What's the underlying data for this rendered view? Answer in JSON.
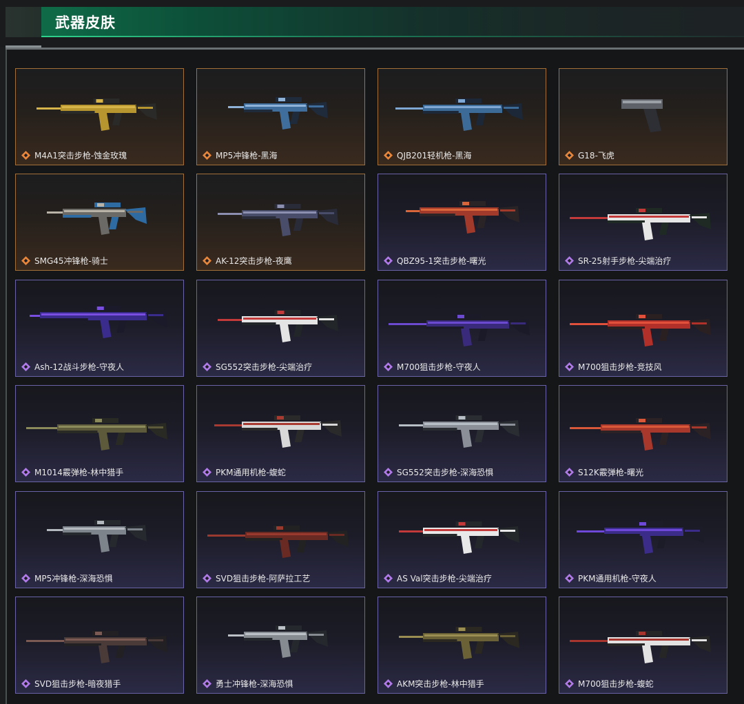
{
  "header": {
    "title": "武器皮肤"
  },
  "colors": {
    "gold_border": "#a4703a",
    "purple_border": "#6b63a8",
    "gold_icon": "#e8863a",
    "purple_icon": "#b07be8",
    "header_green": "#0f6b48"
  },
  "cards": [
    {
      "label": "M4A1突击步枪-蚀金玫瑰",
      "rarity": "gold",
      "icon": "diamond-gold-icon",
      "palette": [
        "#b8962f",
        "#2a2a28",
        "#d8b54a"
      ]
    },
    {
      "label": "MP5冲锋枪-黑海",
      "rarity": "gold",
      "icon": "diamond-gold-icon",
      "palette": [
        "#3f6e9c",
        "#1f2a3a",
        "#8fb3d8"
      ]
    },
    {
      "label": "QJB201轻机枪-黑海",
      "rarity": "gold",
      "icon": "diamond-gold-icon",
      "palette": [
        "#3c6b98",
        "#1c2838",
        "#7fa8d4"
      ]
    },
    {
      "label": "G18-飞虎",
      "rarity": "gold",
      "icon": "diamond-gold-icon",
      "palette": [
        "#2d2f35",
        "#5f6168",
        "#9aa0a6"
      ]
    },
    {
      "label": "SMG45冲锋枪-骑士",
      "rarity": "gold",
      "icon": "diamond-gold-icon",
      "palette": [
        "#6b6a66",
        "#2e6ba3",
        "#b8b3a6"
      ]
    },
    {
      "label": "AK-12突击步枪-夜鹰",
      "rarity": "gold",
      "icon": "diamond-gold-icon",
      "palette": [
        "#4a4d6a",
        "#2a2b38",
        "#8c8fb0"
      ]
    },
    {
      "label": "QBZ95-1突击步枪-曙光",
      "rarity": "purple",
      "icon": "diamond-purple-icon",
      "palette": [
        "#a13a2a",
        "#2a2426",
        "#d9653a"
      ]
    },
    {
      "label": "SR-25射手步枪-尖端治疗",
      "rarity": "purple",
      "icon": "diamond-purple-icon",
      "palette": [
        "#e6e6e6",
        "#1f2a24",
        "#c43a3a"
      ]
    },
    {
      "label": "Ash-12战斗步枪-守夜人",
      "rarity": "purple",
      "icon": "diamond-purple-icon",
      "palette": [
        "#3a2c8c",
        "#1a1a2a",
        "#7a4ee0"
      ]
    },
    {
      "label": "SG552突击步枪-尖端治疗",
      "rarity": "purple",
      "icon": "diamond-purple-icon",
      "palette": [
        "#e4e4e4",
        "#222628",
        "#c43a3a"
      ]
    },
    {
      "label": "M700狙击步枪-守夜人",
      "rarity": "purple",
      "icon": "diamond-purple-icon",
      "palette": [
        "#3a2a7c",
        "#1a1a28",
        "#6b4ad0"
      ]
    },
    {
      "label": "M700狙击步枪-竞技风",
      "rarity": "purple",
      "icon": "diamond-purple-icon",
      "palette": [
        "#b2302a",
        "#2a2022",
        "#e0503a"
      ]
    },
    {
      "label": "M1014霰弹枪-林中猎手",
      "rarity": "purple",
      "icon": "diamond-purple-icon",
      "palette": [
        "#5c5a3a",
        "#2a2a24",
        "#8a8a5a"
      ]
    },
    {
      "label": "PKM通用机枪-蝮蛇",
      "rarity": "purple",
      "icon": "diamond-purple-icon",
      "palette": [
        "#d8d8d8",
        "#2a2a2a",
        "#a83a32"
      ]
    },
    {
      "label": "SG552突击步枪-深海恐惧",
      "rarity": "purple",
      "icon": "diamond-purple-icon",
      "palette": [
        "#8a8f98",
        "#2a2d32",
        "#b8bec6"
      ]
    },
    {
      "label": "S12K霰弹枪-曙光",
      "rarity": "purple",
      "icon": "diamond-purple-icon",
      "palette": [
        "#a8382c",
        "#2a2224",
        "#d9583a"
      ]
    },
    {
      "label": "MP5冲锋枪-深海恐惧",
      "rarity": "purple",
      "icon": "diamond-purple-icon",
      "palette": [
        "#7e848c",
        "#26292e",
        "#b4b9c0"
      ]
    },
    {
      "label": "SVD狙击步枪-阿萨拉工艺",
      "rarity": "purple",
      "icon": "diamond-purple-icon",
      "palette": [
        "#6a2a24",
        "#222222",
        "#9a3a2e"
      ]
    },
    {
      "label": "AS Val突击步枪-尖端治疗",
      "rarity": "purple",
      "icon": "diamond-purple-icon",
      "palette": [
        "#e8e8e8",
        "#24282a",
        "#c43a3a"
      ]
    },
    {
      "label": "PKM通用机枪-守夜人",
      "rarity": "purple",
      "icon": "diamond-purple-icon",
      "palette": [
        "#3a2c88",
        "#1c1c28",
        "#6e48d8"
      ]
    },
    {
      "label": "SVD狙击步枪-暗夜猎手",
      "rarity": "purple",
      "icon": "diamond-purple-icon",
      "palette": [
        "#4a3a38",
        "#222022",
        "#7a5a52"
      ]
    },
    {
      "label": "勇士冲锋枪-深海恐惧",
      "rarity": "purple",
      "icon": "diamond-purple-icon",
      "palette": [
        "#868b92",
        "#25282c",
        "#bcc1c8"
      ]
    },
    {
      "label": "AKM突击步枪-林中猎手",
      "rarity": "purple",
      "icon": "diamond-purple-icon",
      "palette": [
        "#6a6236",
        "#2a2820",
        "#9a8e52"
      ]
    },
    {
      "label": "M700狙击步枪-蝮蛇",
      "rarity": "purple",
      "icon": "diamond-purple-icon",
      "palette": [
        "#e2e2e2",
        "#262626",
        "#a8352e"
      ]
    }
  ]
}
